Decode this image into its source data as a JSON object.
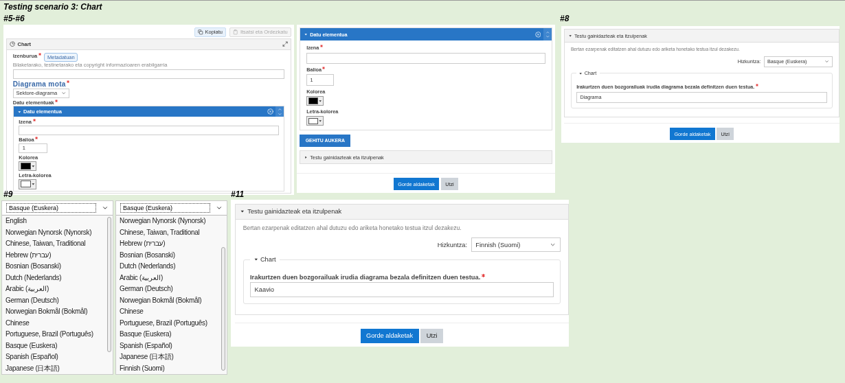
{
  "title": "Testing scenario 3: Chart",
  "editor": {
    "label": "#5-#6",
    "toolbar": [
      {
        "label": "Kopiatu",
        "disabled": false
      },
      {
        "label": "Itsatsi eta Ordezkatu",
        "disabled": true
      }
    ],
    "header": "Chart",
    "title_field": {
      "label": "Izenburua",
      "required": true,
      "badge": "Metadatuan",
      "hint": "Bilaketarako, testinetarako eta copyright informazioaren erabilgarria"
    },
    "type_field": {
      "label": "Diagrama mota",
      "required": true,
      "value": "Sektore-diagrama"
    },
    "items_label": "Datu elementuak",
    "items_required": true,
    "item": {
      "title": "Datu elementua",
      "expanded": true,
      "fields": [
        {
          "kind": "text",
          "label": "Izena",
          "required": true
        },
        {
          "kind": "number",
          "label": "Balioa",
          "required": true,
          "value": "1"
        },
        {
          "kind": "color",
          "label": "Kolorea",
          "required": false,
          "color": "#000000"
        },
        {
          "kind": "color",
          "label": "Letra-kolorea",
          "required": false,
          "color": "#ffffff"
        }
      ]
    }
  },
  "editor_continued": {
    "item": {
      "title": "Datu elementua",
      "expanded": true,
      "fields": [
        {
          "kind": "text",
          "label": "Izena",
          "required": true
        },
        {
          "kind": "number",
          "label": "Balioa",
          "required": true,
          "value": "1"
        },
        {
          "kind": "color",
          "label": "Kolorea",
          "required": false,
          "color": "#000000"
        },
        {
          "kind": "color",
          "label": "Letra-kolorea",
          "required": false,
          "color": "#ffffff"
        }
      ]
    },
    "add_button": "GEHITU AUKERA",
    "section": {
      "title": "Testu gainidazteak eta itzulpenak",
      "expanded": false
    },
    "buttons": [
      {
        "label": "Gorde aldaketak",
        "kind": "primary"
      },
      {
        "label": "Utzi",
        "kind": "secondary"
      }
    ]
  },
  "translations": [
    {
      "label": "#8",
      "section": {
        "title": "Testu gainidazteak eta itzulpenak",
        "expanded": true
      },
      "description": "Bertan ezarpenak editatzen ahal dutuzu edo ariketa honetako testua itzul dezakezu.",
      "language_label": "Hizkuntza:",
      "language": "Basque (Euskera)",
      "group": {
        "title": "Chart",
        "expanded": true
      },
      "field_label": "Irakurtzen duen bozgorailuak irudia diagrama bezala definitzen duen testua.",
      "required": true,
      "value": "Diagrama",
      "buttons": [
        {
          "label": "Gorde aldaketak",
          "kind": "primary"
        },
        {
          "label": "Utzi",
          "kind": "secondary"
        }
      ]
    },
    {
      "label": "#11",
      "section": {
        "title": "Testu gainidazteak eta itzulpenak",
        "expanded": true
      },
      "description": "Bertan ezarpenak editatzen ahal dutuzu edo ariketa honetako testua itzul dezakezu.",
      "language_label": "Hizkuntza:",
      "language": "Finnish (Suomi)",
      "group": {
        "title": "Chart",
        "expanded": true
      },
      "field_label": "Irakurtzen duen bozgorailuak irudia diagrama bezala definitzen duen testua.",
      "required": true,
      "value": "Kaavio",
      "buttons": [
        {
          "label": "Gorde aldaketak",
          "kind": "primary"
        },
        {
          "label": "Utzi",
          "kind": "secondary"
        }
      ]
    }
  ],
  "language_lists": {
    "label": "#9",
    "lists": [
      {
        "value": "Basque (Euskera)",
        "options": [
          "English",
          "Norwegian Nynorsk (Nynorsk)",
          "Chinese, Taiwan, Traditional",
          "Hebrew (עברית)",
          "Bosnian (Bosanski)",
          "Dutch (Nederlands)",
          "Arabic (العربية)",
          "German (Deutsch)",
          "Norwegian Bokmål (Bokmål)",
          "Chinese",
          "Portuguese, Brazil (Português)",
          "Basque (Euskera)",
          "Spanish (Español)",
          "Japanese (日本語)"
        ]
      },
      {
        "value": "Basque (Euskera)",
        "options": [
          "Norwegian Nynorsk (Nynorsk)",
          "Chinese, Taiwan, Traditional",
          "Hebrew (עברית)",
          "Bosnian (Bosanski)",
          "Dutch (Nederlands)",
          "Arabic (العربية)",
          "German (Deutsch)",
          "Norwegian Bokmål (Bokmål)",
          "Chinese",
          "Portuguese, Brazil (Português)",
          "Basque (Euskera)",
          "Spanish (Español)",
          "Japanese (日本語)",
          "Finnish (Suomi)"
        ]
      }
    ]
  }
}
